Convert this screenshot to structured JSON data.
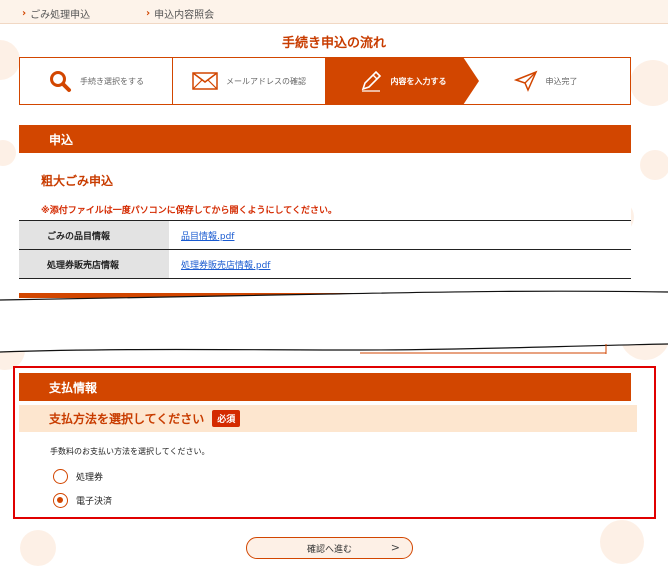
{
  "breadcrumb": {
    "items": [
      {
        "label": "ごみ処理申込"
      },
      {
        "label": "申込内容照会"
      }
    ]
  },
  "flow": {
    "title": "手続き申込の流れ",
    "steps": [
      {
        "label": "手続き選択をする",
        "icon": "search-icon"
      },
      {
        "label": "メールアドレスの確認",
        "icon": "mail-icon"
      },
      {
        "label": "内容を入力する",
        "icon": "pencil-icon"
      },
      {
        "label": "申込完了",
        "icon": "send-icon"
      }
    ]
  },
  "application": {
    "header": "申込",
    "subtitle": "粗大ごみ申込",
    "notice": "※添付ファイルは一度パソコンに保存してから開くようにしてください。",
    "rows": [
      {
        "label": "ごみの品目情報",
        "link": "品目情報.pdf"
      },
      {
        "label": "処理券販売店情報",
        "link": "処理券販売店情報.pdf"
      }
    ]
  },
  "payment": {
    "header": "支払情報",
    "title": "支払方法を選択してください",
    "required": "必須",
    "description": "手数料のお支払い方法を選択してください。",
    "options": [
      {
        "label": "処理券",
        "checked": false
      },
      {
        "label": "電子決済",
        "checked": true
      }
    ]
  },
  "confirm": {
    "label": "確認へ進む",
    "arrow": ">"
  },
  "colors": {
    "accent": "#d24600",
    "highlight": "#e00000",
    "link": "#1a5bd1"
  }
}
